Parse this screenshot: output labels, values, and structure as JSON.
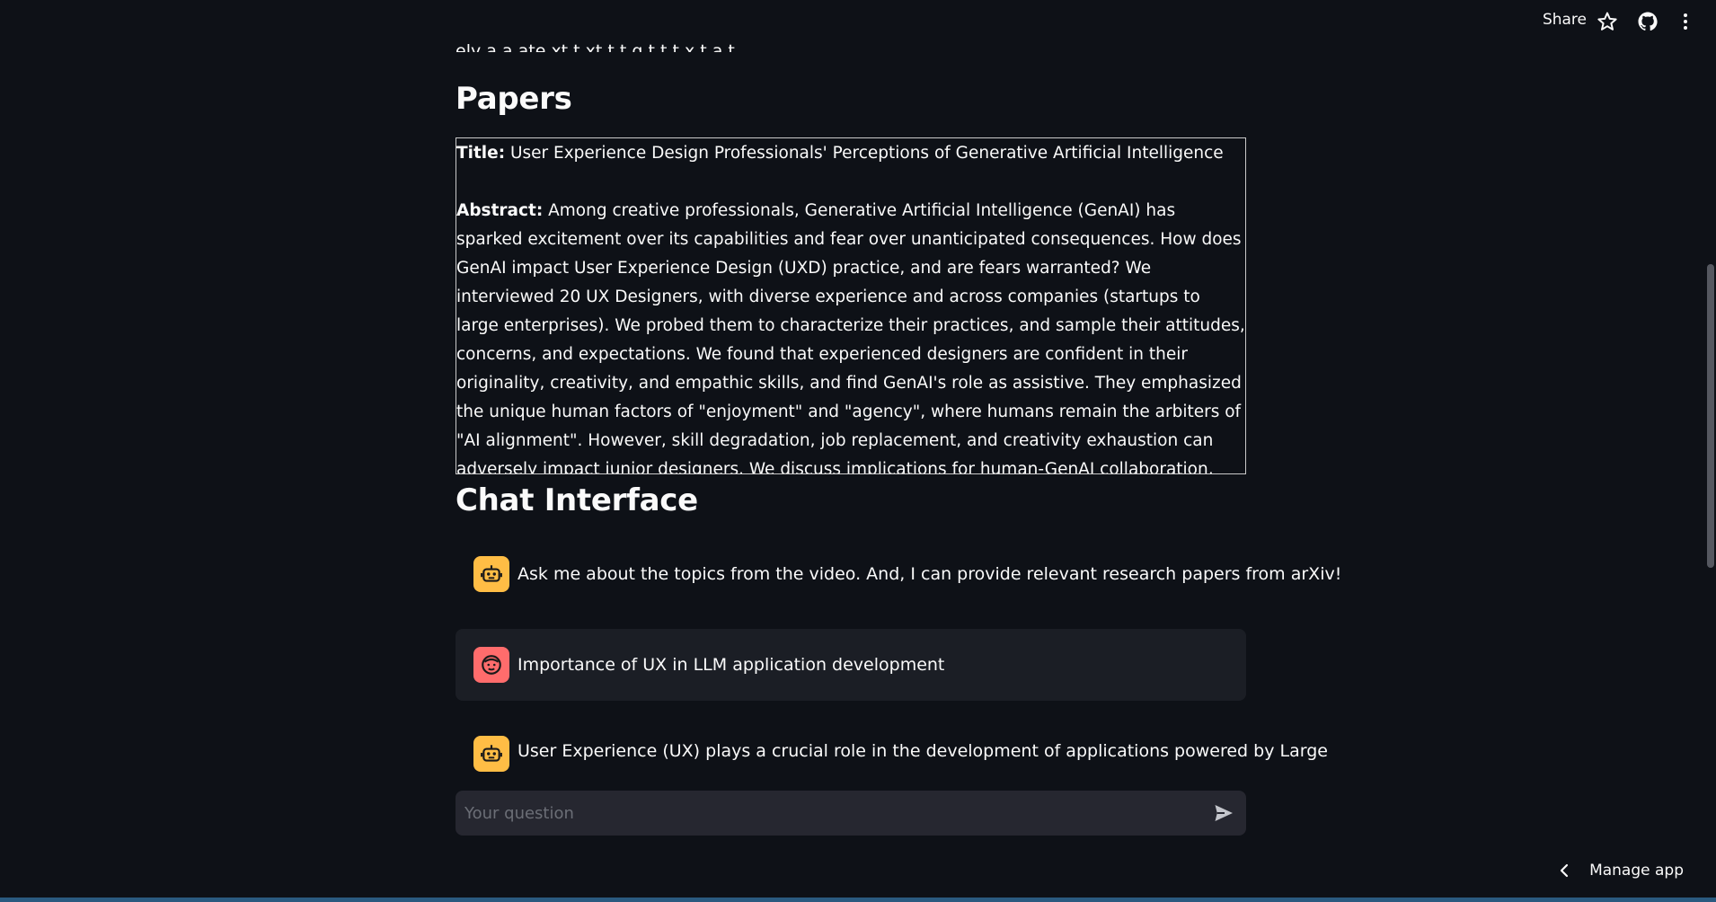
{
  "header": {
    "share_label": "Share",
    "icons": [
      "star-icon",
      "github-icon",
      "more-vertical-icon"
    ]
  },
  "top_cut_text": "ely a a   ate xt t xt t t g  t t  t x t a t  ",
  "papers": {
    "heading": "Papers",
    "title_label": "Title:",
    "title": "User Experience Design Professionals' Perceptions of Generative Artificial Intelligence",
    "abstract_label": "Abstract:",
    "abstract": "Among creative professionals, Generative Artificial Intelligence (GenAI) has sparked excitement over its capabilities and fear over unanticipated consequences. How does GenAI impact User Experience Design (UXD) practice, and are fears warranted? We interviewed 20 UX Designers, with diverse experience and across companies (startups to large enterprises). We probed them to characterize their practices, and sample their attitudes, concerns, and expectations. We found that experienced designers are confident in their originality, creativity, and empathic skills, and find GenAI's role as assistive. They emphasized the unique human factors of \"enjoyment\" and \"agency\", where humans remain the arbiters of \"AI alignment\". However, skill degradation, job replacement, and creativity exhaustion can adversely impact junior designers. We discuss implications for human-GenAI collaboration, specifically copyright and ownership, human creativity and agency, and AI literacy and access. Through the lens of responsible"
  },
  "chat": {
    "heading": "Chat Interface",
    "messages": [
      {
        "role": "assistant",
        "icon": "robot-icon",
        "text": "Ask me about the topics from the video. And, I can provide relevant research papers from arXiv!"
      },
      {
        "role": "user",
        "icon": "face-icon",
        "text": "Importance of UX in LLM application development"
      },
      {
        "role": "assistant",
        "icon": "robot-icon",
        "text": "User Experience (UX) plays a crucial role in the development of applications powered by Large"
      }
    ],
    "input": {
      "placeholder": "Your question",
      "value": ""
    }
  },
  "footer": {
    "manage_app_label": "Manage app"
  },
  "colors": {
    "background": "#0e1117",
    "assistant_avatar": "#ffbd45",
    "user_avatar": "#ff6c6c",
    "input_bg": "#262730",
    "user_msg_bg": "#1b1e25"
  }
}
